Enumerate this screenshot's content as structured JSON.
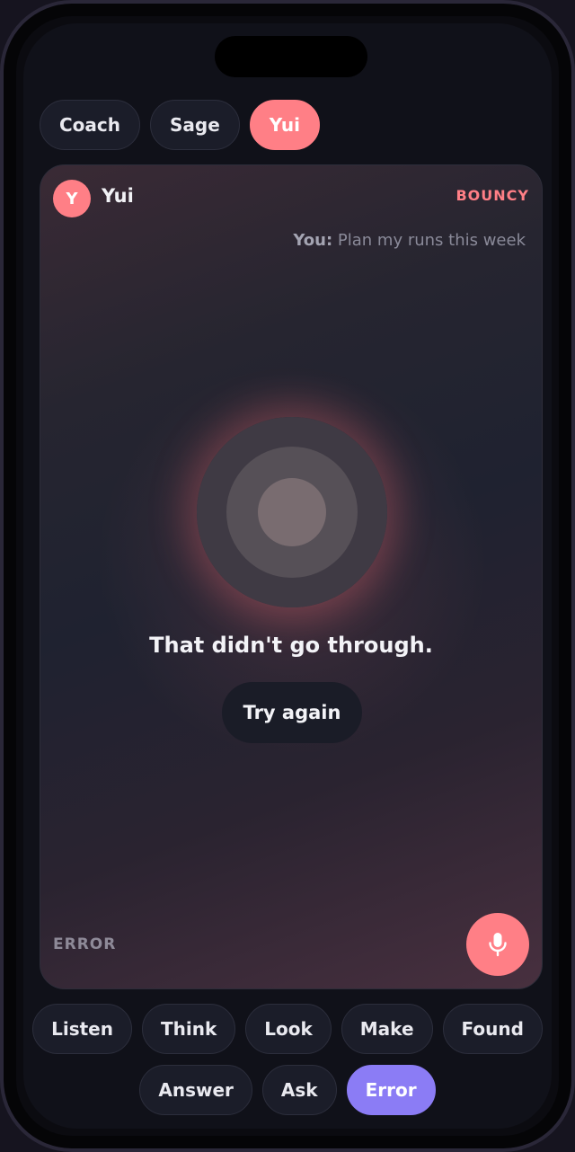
{
  "personas": [
    {
      "label": "Coach",
      "active": false
    },
    {
      "label": "Sage",
      "active": false
    },
    {
      "label": "Yui",
      "active": true
    }
  ],
  "card": {
    "avatar_initial": "Y",
    "persona_name": "Yui",
    "mood": "BOUNCY",
    "transcript_speaker": "You:",
    "transcript_text": "Plan my runs this week",
    "status_message": "That didn't go through.",
    "retry_label": "Try again",
    "state_label": "ERROR",
    "mic_icon": "mic-icon"
  },
  "states": [
    [
      "Listen",
      "Think",
      "Look",
      "Make",
      "Found"
    ],
    [
      "Answer",
      "Ask",
      "Error"
    ]
  ],
  "selected_state": "Error",
  "colors": {
    "accent": "#ff7f86",
    "selected_state": "#8b7cf5",
    "pill_bg": "#1b1d29",
    "screen_bg": "#101119"
  }
}
